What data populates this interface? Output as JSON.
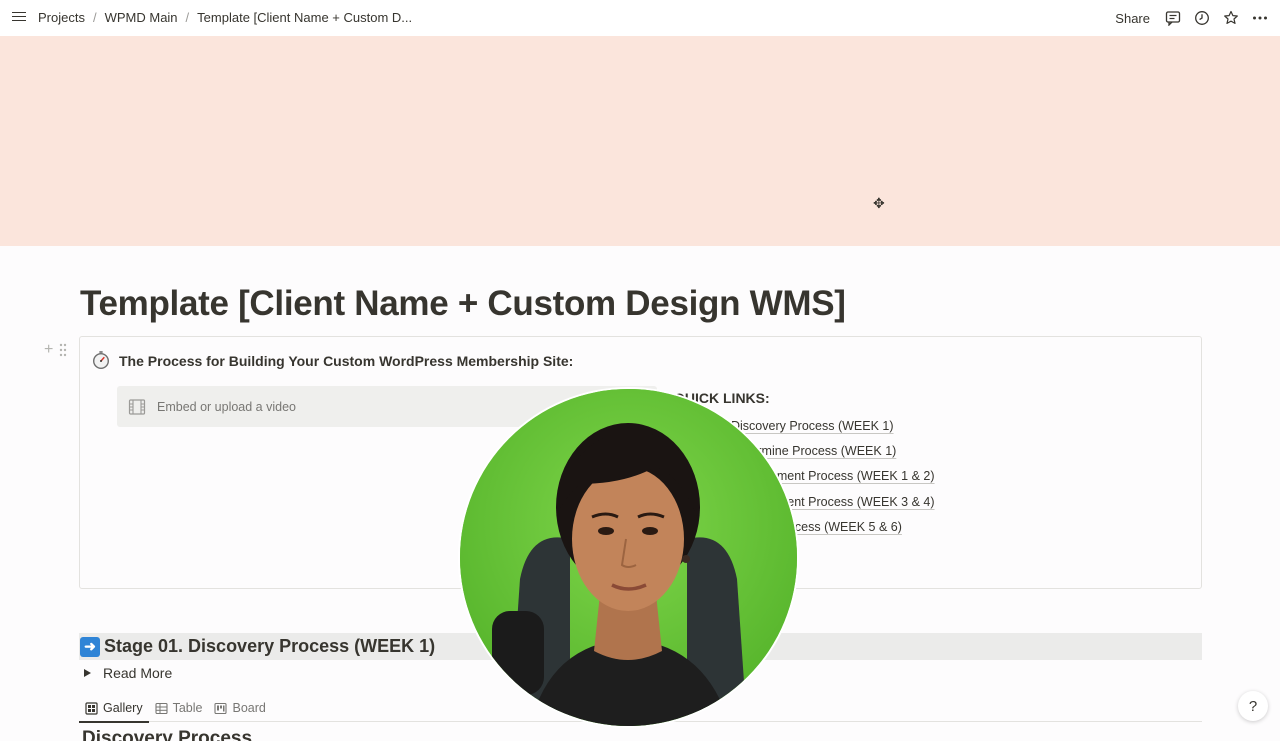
{
  "breadcrumb": [
    "Projects",
    "WPMD Main",
    "Template [Client Name + Custom D..."
  ],
  "breadcrumb_separator": "/",
  "topbar": {
    "share_label": "Share",
    "icons": [
      "comment-icon",
      "history-icon",
      "star-icon",
      "more-icon"
    ]
  },
  "cover": {
    "color": "#fbe5dc",
    "reposition_glyph": "✥"
  },
  "page": {
    "title": "Template [Client Name + Custom Design WMS]"
  },
  "block_handle": {
    "plus_glyph": "+"
  },
  "callout": {
    "icon": "stopwatch-icon",
    "title": "The Process for Building Your Custom WordPress Membership Site:",
    "video_placeholder": "Embed or upload a video",
    "quick_links_title": "QUICK LINKS:",
    "quick_links": [
      "Stage 01. Discovery Process (WEEK 1)",
      "Stage 02. Determine Process (WEEK 1)",
      "Stage 03. Development Process (WEEK 1 & 2)",
      "Stage 04. Development Process (WEEK 3 & 4)",
      "Stage 05. Launch Process (WEEK 5 & 6)"
    ]
  },
  "stage": {
    "icon": "arrow-right-icon",
    "arrow_glyph": "➜",
    "title": "Stage 01. Discovery Process (WEEK 1)"
  },
  "toggle": {
    "label": "Read More"
  },
  "views": {
    "tabs": [
      {
        "label": "Gallery",
        "icon": "gallery-icon",
        "active": true
      },
      {
        "label": "Table",
        "icon": "table-icon",
        "active": false
      },
      {
        "label": "Board",
        "icon": "board-icon",
        "active": false
      }
    ]
  },
  "gallery_heading": "Discovery Process",
  "help": {
    "label": "?"
  }
}
